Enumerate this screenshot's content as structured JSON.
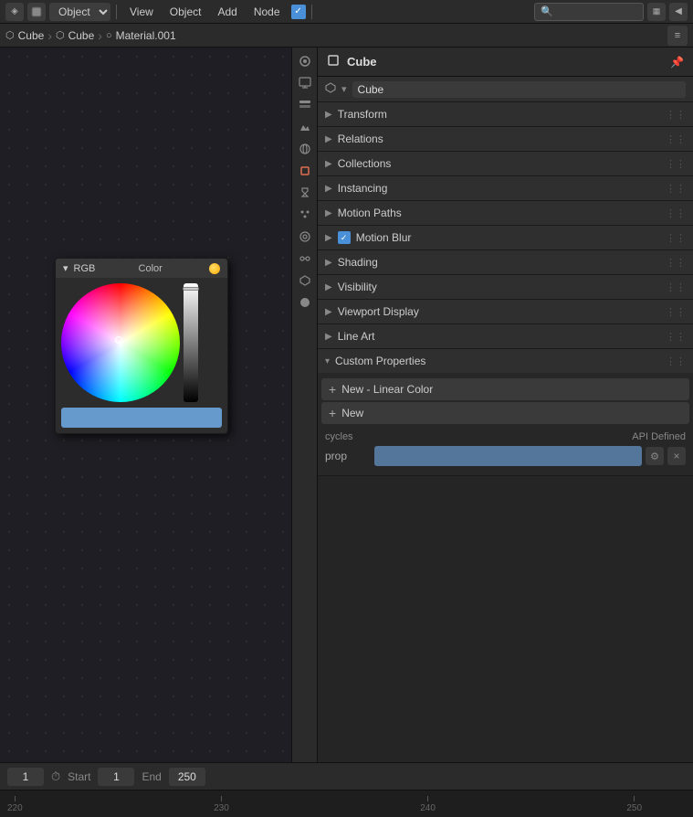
{
  "topbar": {
    "object_mode_label": "Object",
    "menu_items": [
      "View",
      "Object",
      "Add",
      "Node"
    ],
    "search_placeholder": "Search",
    "engine_icon": "▦",
    "expand_icon": "◀"
  },
  "breadcrumb": {
    "icon1": "⬡",
    "item1": "Cube",
    "icon2": "⬡",
    "item2": "Cube",
    "icon3": "○",
    "item3": "Material.001"
  },
  "color_picker": {
    "title": "RGB",
    "color_label": "Color",
    "collapse_icon": "▾"
  },
  "properties": {
    "title": "Cube",
    "object_name": "Cube",
    "sections": [
      {
        "label": "Transform",
        "expanded": false
      },
      {
        "label": "Relations",
        "expanded": false
      },
      {
        "label": "Collections",
        "expanded": false
      },
      {
        "label": "Instancing",
        "expanded": false
      },
      {
        "label": "Motion Paths",
        "expanded": false
      },
      {
        "label": "Motion Blur",
        "expanded": false,
        "has_check": true
      },
      {
        "label": "Shading",
        "expanded": false
      },
      {
        "label": "Visibility",
        "expanded": false
      },
      {
        "label": "Viewport Display",
        "expanded": false
      },
      {
        "label": "Line Art",
        "expanded": false
      },
      {
        "label": "Custom Properties",
        "expanded": true
      }
    ],
    "custom_props": {
      "add_button_label": "New - Linear Color",
      "add_button2_label": "New",
      "table_col1": "cycles",
      "table_col2": "API Defined",
      "prop_name": "prop",
      "prop_gear_icon": "⚙",
      "prop_close_icon": "×"
    }
  },
  "side_icons": [
    {
      "name": "render-icon",
      "symbol": "📷",
      "active": false
    },
    {
      "name": "output-icon",
      "symbol": "🖨",
      "active": false
    },
    {
      "name": "view-layer-icon",
      "symbol": "🗂",
      "active": false
    },
    {
      "name": "scene-icon",
      "symbol": "🎬",
      "active": false
    },
    {
      "name": "world-icon",
      "symbol": "🌐",
      "active": false
    },
    {
      "name": "object-icon",
      "symbol": "⬡",
      "active": true
    },
    {
      "name": "modifier-icon",
      "symbol": "🔧",
      "active": false
    },
    {
      "name": "particles-icon",
      "symbol": "✦",
      "active": false
    },
    {
      "name": "physics-icon",
      "symbol": "◎",
      "active": false
    },
    {
      "name": "constraints-icon",
      "symbol": "🔗",
      "active": false
    },
    {
      "name": "data-icon",
      "symbol": "△",
      "active": false
    },
    {
      "name": "material-icon",
      "symbol": "●",
      "active": false
    }
  ],
  "timeline": {
    "current_frame": "1",
    "start_frame": "1",
    "end_frame": "250",
    "start_label": "Start",
    "end_label": "End"
  },
  "ruler": {
    "marks": [
      "220",
      "230",
      "240",
      "250"
    ]
  }
}
